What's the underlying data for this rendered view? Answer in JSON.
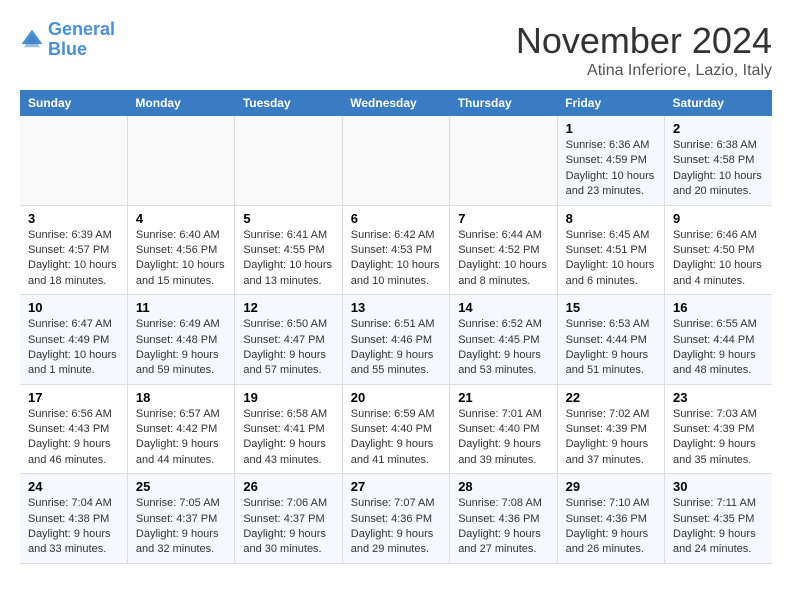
{
  "logo": {
    "line1": "General",
    "line2": "Blue"
  },
  "title": "November 2024",
  "location": "Atina Inferiore, Lazio, Italy",
  "weekdays": [
    "Sunday",
    "Monday",
    "Tuesday",
    "Wednesday",
    "Thursday",
    "Friday",
    "Saturday"
  ],
  "weeks": [
    [
      {
        "day": "",
        "info": ""
      },
      {
        "day": "",
        "info": ""
      },
      {
        "day": "",
        "info": ""
      },
      {
        "day": "",
        "info": ""
      },
      {
        "day": "",
        "info": ""
      },
      {
        "day": "1",
        "info": "Sunrise: 6:36 AM\nSunset: 4:59 PM\nDaylight: 10 hours and 23 minutes."
      },
      {
        "day": "2",
        "info": "Sunrise: 6:38 AM\nSunset: 4:58 PM\nDaylight: 10 hours and 20 minutes."
      }
    ],
    [
      {
        "day": "3",
        "info": "Sunrise: 6:39 AM\nSunset: 4:57 PM\nDaylight: 10 hours and 18 minutes."
      },
      {
        "day": "4",
        "info": "Sunrise: 6:40 AM\nSunset: 4:56 PM\nDaylight: 10 hours and 15 minutes."
      },
      {
        "day": "5",
        "info": "Sunrise: 6:41 AM\nSunset: 4:55 PM\nDaylight: 10 hours and 13 minutes."
      },
      {
        "day": "6",
        "info": "Sunrise: 6:42 AM\nSunset: 4:53 PM\nDaylight: 10 hours and 10 minutes."
      },
      {
        "day": "7",
        "info": "Sunrise: 6:44 AM\nSunset: 4:52 PM\nDaylight: 10 hours and 8 minutes."
      },
      {
        "day": "8",
        "info": "Sunrise: 6:45 AM\nSunset: 4:51 PM\nDaylight: 10 hours and 6 minutes."
      },
      {
        "day": "9",
        "info": "Sunrise: 6:46 AM\nSunset: 4:50 PM\nDaylight: 10 hours and 4 minutes."
      }
    ],
    [
      {
        "day": "10",
        "info": "Sunrise: 6:47 AM\nSunset: 4:49 PM\nDaylight: 10 hours and 1 minute."
      },
      {
        "day": "11",
        "info": "Sunrise: 6:49 AM\nSunset: 4:48 PM\nDaylight: 9 hours and 59 minutes."
      },
      {
        "day": "12",
        "info": "Sunrise: 6:50 AM\nSunset: 4:47 PM\nDaylight: 9 hours and 57 minutes."
      },
      {
        "day": "13",
        "info": "Sunrise: 6:51 AM\nSunset: 4:46 PM\nDaylight: 9 hours and 55 minutes."
      },
      {
        "day": "14",
        "info": "Sunrise: 6:52 AM\nSunset: 4:45 PM\nDaylight: 9 hours and 53 minutes."
      },
      {
        "day": "15",
        "info": "Sunrise: 6:53 AM\nSunset: 4:44 PM\nDaylight: 9 hours and 51 minutes."
      },
      {
        "day": "16",
        "info": "Sunrise: 6:55 AM\nSunset: 4:44 PM\nDaylight: 9 hours and 48 minutes."
      }
    ],
    [
      {
        "day": "17",
        "info": "Sunrise: 6:56 AM\nSunset: 4:43 PM\nDaylight: 9 hours and 46 minutes."
      },
      {
        "day": "18",
        "info": "Sunrise: 6:57 AM\nSunset: 4:42 PM\nDaylight: 9 hours and 44 minutes."
      },
      {
        "day": "19",
        "info": "Sunrise: 6:58 AM\nSunset: 4:41 PM\nDaylight: 9 hours and 43 minutes."
      },
      {
        "day": "20",
        "info": "Sunrise: 6:59 AM\nSunset: 4:40 PM\nDaylight: 9 hours and 41 minutes."
      },
      {
        "day": "21",
        "info": "Sunrise: 7:01 AM\nSunset: 4:40 PM\nDaylight: 9 hours and 39 minutes."
      },
      {
        "day": "22",
        "info": "Sunrise: 7:02 AM\nSunset: 4:39 PM\nDaylight: 9 hours and 37 minutes."
      },
      {
        "day": "23",
        "info": "Sunrise: 7:03 AM\nSunset: 4:39 PM\nDaylight: 9 hours and 35 minutes."
      }
    ],
    [
      {
        "day": "24",
        "info": "Sunrise: 7:04 AM\nSunset: 4:38 PM\nDaylight: 9 hours and 33 minutes."
      },
      {
        "day": "25",
        "info": "Sunrise: 7:05 AM\nSunset: 4:37 PM\nDaylight: 9 hours and 32 minutes."
      },
      {
        "day": "26",
        "info": "Sunrise: 7:06 AM\nSunset: 4:37 PM\nDaylight: 9 hours and 30 minutes."
      },
      {
        "day": "27",
        "info": "Sunrise: 7:07 AM\nSunset: 4:36 PM\nDaylight: 9 hours and 29 minutes."
      },
      {
        "day": "28",
        "info": "Sunrise: 7:08 AM\nSunset: 4:36 PM\nDaylight: 9 hours and 27 minutes."
      },
      {
        "day": "29",
        "info": "Sunrise: 7:10 AM\nSunset: 4:36 PM\nDaylight: 9 hours and 26 minutes."
      },
      {
        "day": "30",
        "info": "Sunrise: 7:11 AM\nSunset: 4:35 PM\nDaylight: 9 hours and 24 minutes."
      }
    ]
  ]
}
